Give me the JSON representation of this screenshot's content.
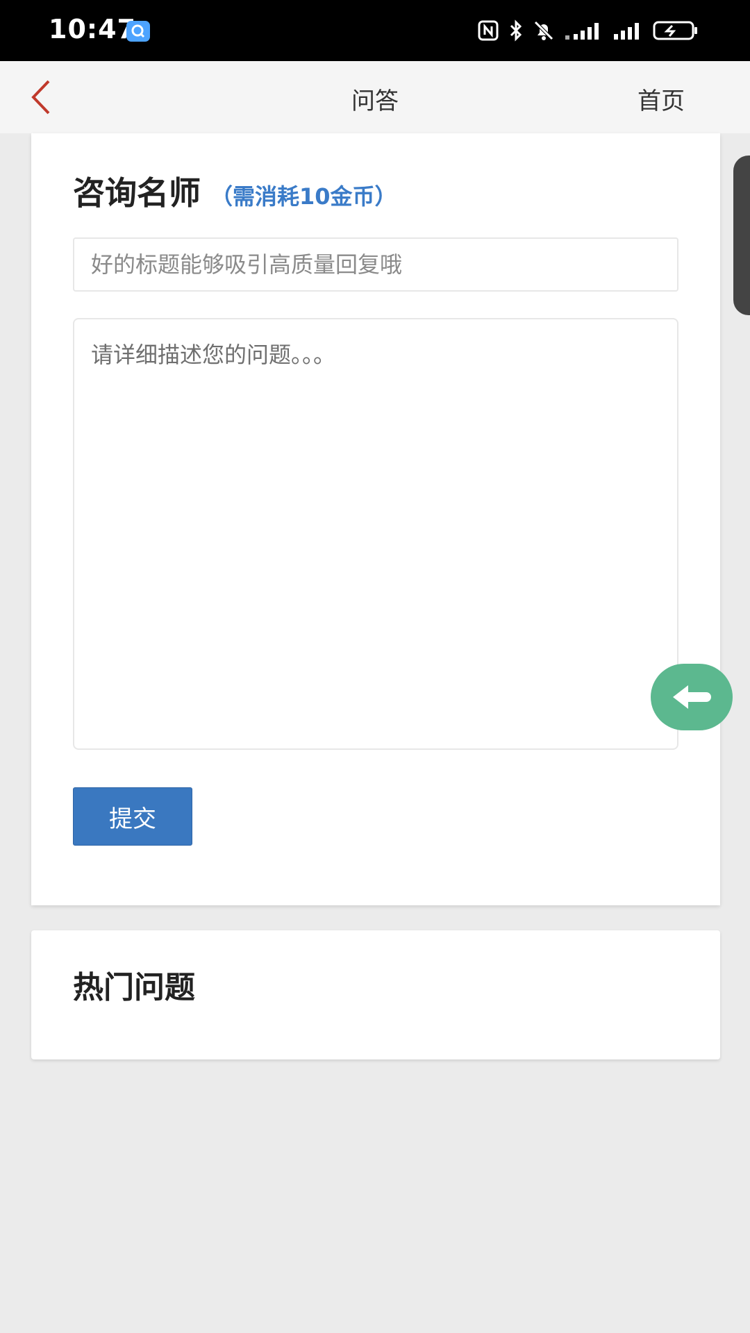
{
  "status_bar": {
    "time": "10:47",
    "app_icon": "message-search-icon",
    "icons": [
      "nfc-icon",
      "bluetooth-icon",
      "mute-bell-icon",
      "signal-icon",
      "signal-icon",
      "battery-charging-icon"
    ]
  },
  "nav": {
    "back_icon": "chevron-left-icon",
    "title": "问答",
    "home_label": "首页",
    "back_color": "#c0392b"
  },
  "ask": {
    "title": "咨询名师",
    "cost_note": "（需消耗10金币）",
    "title_placeholder": "好的标题能够吸引高质量回复哦",
    "desc_placeholder": "请详细描述您的问题。。。",
    "submit_label": "提交"
  },
  "hot": {
    "title": "热门问题"
  },
  "floating_button": {
    "icon": "arrow-left-icon",
    "color": "#5cb88f"
  },
  "colors": {
    "accent_blue": "#3a7bc8",
    "button_blue": "#3a78c0",
    "page_bg": "#ebebeb"
  }
}
